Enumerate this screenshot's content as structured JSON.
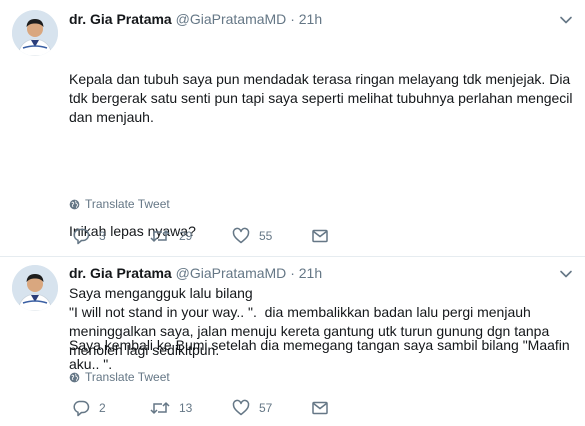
{
  "tweets": [
    {
      "author_name": "dr. Gia Pratama",
      "handle": "@GiaPratamaMD",
      "separator": "·",
      "time": "21h",
      "paragraphs": [
        "Kepala dan tubuh saya pun mendadak terasa ringan melayang tdk menjejak. Dia tdk bergerak satu senti pun tapi saya seperti melihat tubuhnya perlahan mengecil dan menjauh.",
        "Inikah lepas nyawa?",
        "Saya kembali ke Bumi setelah dia memegang tangan saya sambil bilang \"Maafin aku.. \"."
      ],
      "translate_label": "Translate Tweet",
      "replies": "3",
      "retweets": "29",
      "likes": "55"
    },
    {
      "author_name": "dr. Gia Pratama",
      "handle": "@GiaPratamaMD",
      "separator": "·",
      "time": "21h",
      "text": "Saya mengangguk lalu bilang\n\"I will not stand in your way.. \".  dia membalikkan badan lalu pergi menjauh meninggalkan saya, jalan menuju kereta gantung utk turun gunung dgn tanpa menoleh lagi sedikitpun.",
      "translate_label": "Translate Tweet",
      "replies": "2",
      "retweets": "13",
      "likes": "57"
    }
  ],
  "icons": {
    "caret": "chevron-down-icon",
    "globe": "globe-icon",
    "reply": "reply-icon",
    "retweet": "retweet-icon",
    "like": "heart-icon",
    "message": "envelope-icon"
  },
  "colors": {
    "text": "#14171a",
    "muted": "#657786",
    "divider": "#e6ecf0"
  }
}
